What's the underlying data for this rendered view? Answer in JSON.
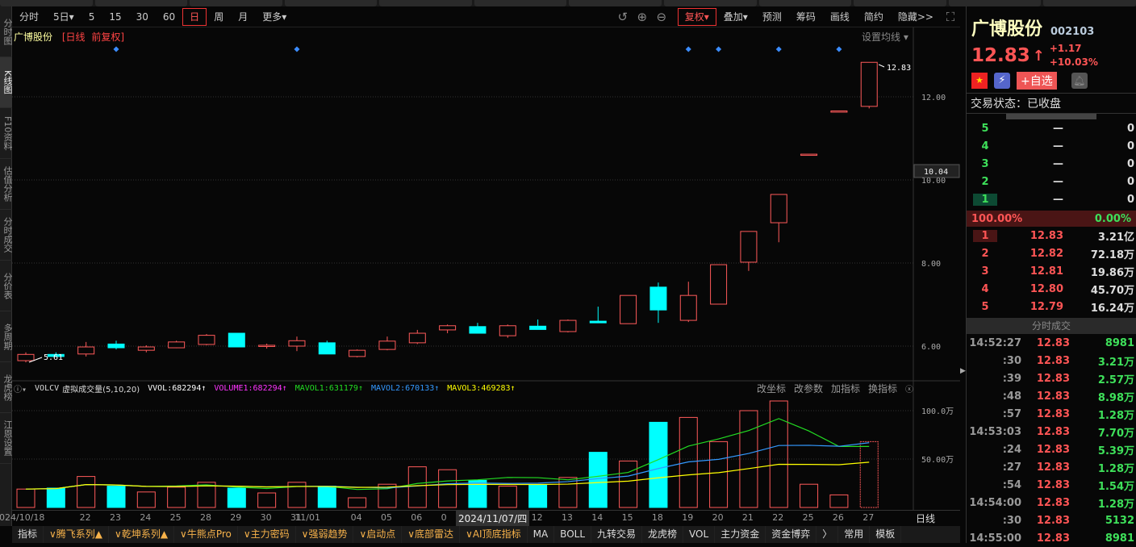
{
  "sidebar": [
    "分时图",
    "K线图",
    "F10资料",
    "估值分析",
    "分时成交",
    "分价表",
    "多周期",
    "龙虎榜",
    "江恩设置"
  ],
  "toolbar": {
    "left": [
      "分时",
      "5日▾",
      "5",
      "15",
      "30",
      "60",
      "日",
      "周",
      "月",
      "更多▾"
    ],
    "selected": "日",
    "fuquan": "复权▾",
    "right": [
      "叠加▾",
      "预测",
      "筹码",
      "画线",
      "简约",
      "隐藏>>"
    ]
  },
  "chart_title": {
    "name": "广博股份",
    "period": "[日线",
    "adj": "前复权]",
    "ma_setting": "设置均线 ▾"
  },
  "price_axis": [
    "12.00",
    "10.00",
    "8.00",
    "6.00"
  ],
  "current_price_label": "10.04",
  "high_label": "12.83",
  "low_label": "5.61",
  "indicator": {
    "name": "VOLCV",
    "title": "虚拟成交量(5,10,20)",
    "vvol": "VVOL:682294↑",
    "volume1": "VOLUME1:682294↑",
    "mavol1": "MAVOL1:631179↑",
    "mavol2": "MAVOL2:670133↑",
    "mavol3": "MAVOL3:469283↑",
    "buttons": [
      "改坐标",
      "改参数",
      "加指标",
      "换指标"
    ]
  },
  "vol_axis": [
    "100.0万",
    "50.00万"
  ],
  "dates": [
    "2024/10/18",
    "",
    "22",
    "23",
    "24",
    "25",
    "28",
    "29",
    "30",
    "31",
    "11/01",
    "04",
    "05",
    "06",
    "0",
    "",
    "11",
    "12",
    "13",
    "14",
    "15",
    "18",
    "19",
    "20",
    "21",
    "22",
    "25",
    "26",
    "27"
  ],
  "date_cursor": "2024/11/07/四",
  "period_label": "日线",
  "colors": {
    "up": "#ff5a5a",
    "down": "#00ffff",
    "ma1": "#22dd22",
    "ma2": "#3399ff",
    "ma3": "#ffff00"
  },
  "chart_data": {
    "type": "candlestick",
    "ohlc": [
      [
        5.65,
        5.85,
        5.61,
        5.8
      ],
      [
        5.8,
        5.85,
        5.75,
        5.75
      ],
      [
        5.81,
        6.1,
        5.75,
        5.98
      ],
      [
        6.05,
        6.13,
        5.92,
        5.96
      ],
      [
        5.9,
        6.02,
        5.85,
        5.98
      ],
      [
        5.96,
        6.13,
        5.95,
        6.1
      ],
      [
        6.04,
        6.29,
        6.02,
        6.26
      ],
      [
        6.31,
        6.31,
        5.98,
        5.98
      ],
      [
        6.0,
        6.06,
        5.94,
        6.02
      ],
      [
        6.0,
        6.23,
        5.88,
        6.13
      ],
      [
        6.08,
        6.13,
        5.81,
        5.81
      ],
      [
        5.75,
        5.92,
        5.73,
        5.9
      ],
      [
        5.92,
        6.23,
        5.9,
        6.12
      ],
      [
        6.08,
        6.39,
        6.05,
        6.31
      ],
      [
        6.39,
        6.52,
        6.31,
        6.49
      ],
      [
        6.47,
        6.56,
        6.31,
        6.31
      ],
      [
        6.25,
        6.52,
        6.2,
        6.49
      ],
      [
        6.48,
        6.64,
        6.4,
        6.4
      ],
      [
        6.35,
        6.64,
        6.33,
        6.62
      ],
      [
        6.6,
        6.95,
        6.56,
        6.56
      ],
      [
        6.54,
        7.22,
        6.54,
        7.22
      ],
      [
        7.42,
        7.53,
        6.56,
        6.87
      ],
      [
        6.62,
        7.55,
        6.58,
        7.22
      ],
      [
        7.01,
        7.96,
        7.01,
        7.96
      ],
      [
        8.02,
        8.76,
        7.81,
        8.76
      ],
      [
        8.97,
        9.65,
        8.5,
        9.65
      ],
      [
        10.62,
        10.62,
        10.62,
        10.62
      ],
      [
        11.66,
        11.66,
        11.66,
        11.66
      ],
      [
        11.77,
        12.83,
        11.72,
        12.83
      ]
    ],
    "volume_wan": [
      19,
      20,
      32,
      22,
      16,
      21,
      26,
      20,
      15,
      26,
      22,
      10,
      24,
      42,
      39,
      28,
      22,
      23,
      31,
      57,
      48,
      88,
      93,
      68,
      100,
      110,
      24,
      13,
      68
    ],
    "markers": [
      3,
      9,
      22,
      23,
      25,
      27
    ],
    "ylim": [
      5.4,
      13.2
    ]
  },
  "right": {
    "name": "广博股份",
    "code": "002103",
    "price": "12.83",
    "arrow": "↑",
    "change": "+1.17",
    "pct": "+10.03%",
    "add_watch": "+自选",
    "status": "交易状态：已收盘",
    "sell": [
      [
        "5",
        "—",
        "0"
      ],
      [
        "4",
        "—",
        "0"
      ],
      [
        "3",
        "—",
        "0"
      ],
      [
        "2",
        "—",
        "0"
      ],
      [
        "1",
        "—",
        "0"
      ]
    ],
    "ratio_left": "100.00%",
    "ratio_right": "0.00%",
    "buy": [
      [
        "1",
        "12.83",
        "3.21亿"
      ],
      [
        "2",
        "12.82",
        "72.18万"
      ],
      [
        "3",
        "12.81",
        "19.86万"
      ],
      [
        "4",
        "12.80",
        "45.70万"
      ],
      [
        "5",
        "12.79",
        "16.24万"
      ]
    ],
    "ticks_title": "分时成交",
    "ticks": [
      [
        "14:52:27",
        "12.83",
        "8981"
      ],
      [
        ":30",
        "12.83",
        "3.21万"
      ],
      [
        ":39",
        "12.83",
        "2.57万"
      ],
      [
        ":48",
        "12.83",
        "8.98万"
      ],
      [
        ":57",
        "12.83",
        "1.28万"
      ],
      [
        "14:53:03",
        "12.83",
        "7.70万"
      ],
      [
        ":24",
        "12.83",
        "5.39万"
      ],
      [
        ":27",
        "12.83",
        "1.28万"
      ],
      [
        ":54",
        "12.83",
        "1.54万"
      ],
      [
        "14:54:00",
        "12.83",
        "1.28万"
      ],
      [
        ":30",
        "12.83",
        "5132"
      ],
      [
        "14:55:00",
        "12.83",
        "8981"
      ]
    ]
  },
  "bottom": {
    "tabs": [
      "指标",
      "∨腾飞系列▲",
      "∨乾坤系列▲",
      "∨牛熊点Pro",
      "∨主力密码",
      "∨强弱趋势",
      "∨启动点",
      "∨底部雷达",
      "∨AI顶底指标",
      "MA",
      "BOLL",
      "九转交易",
      "龙虎榜",
      "VOL",
      "主力资金",
      "资金博弈",
      "〉",
      "常用",
      "模板"
    ]
  }
}
